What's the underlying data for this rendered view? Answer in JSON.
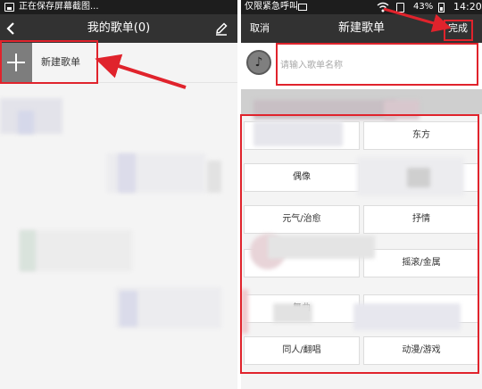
{
  "left": {
    "status_text": "正在保存屏幕截图...",
    "title": "我的歌单(0)",
    "new_playlist_label": "新建歌单"
  },
  "right": {
    "status_text": "仅限紧急呼叫",
    "battery_percent": "43%",
    "time": "14:20",
    "cancel_label": "取消",
    "title": "新建歌单",
    "done_label": "完成",
    "name_placeholder": "请输入歌单名称",
    "tags": [
      {
        "label": ""
      },
      {
        "label": "东方"
      },
      {
        "label": "偶像"
      },
      {
        "label": ""
      },
      {
        "label": "元气/治愈"
      },
      {
        "label": "抒情"
      },
      {
        "label": ""
      },
      {
        "label": "摇滚/金属"
      },
      {
        "label": "舞曲"
      },
      {
        "label": ""
      },
      {
        "label": "同人/翻唱"
      },
      {
        "label": "动漫/游戏"
      }
    ]
  },
  "colors": {
    "annotation_red": "#e0232c",
    "titlebar": "#323232",
    "statusbar": "#1d1d1d"
  },
  "icons": [
    "back-arrow-icon",
    "edit-pencil-icon",
    "plus-icon",
    "music-disc-icon",
    "wifi-icon",
    "battery-icon"
  ]
}
